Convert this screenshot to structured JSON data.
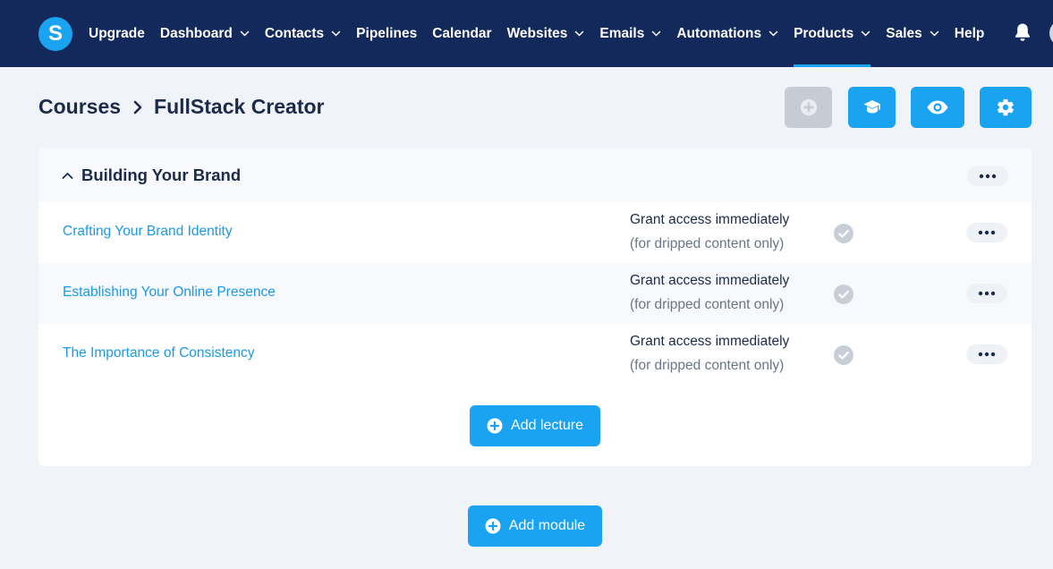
{
  "app": {
    "logo_letter": "S"
  },
  "nav": {
    "items": [
      {
        "label": "Upgrade",
        "dropdown": false
      },
      {
        "label": "Dashboard",
        "dropdown": true
      },
      {
        "label": "Contacts",
        "dropdown": true
      },
      {
        "label": "Pipelines",
        "dropdown": false
      },
      {
        "label": "Calendar",
        "dropdown": false
      },
      {
        "label": "Websites",
        "dropdown": true
      },
      {
        "label": "Emails",
        "dropdown": true
      },
      {
        "label": "Automations",
        "dropdown": true
      },
      {
        "label": "Products",
        "dropdown": true,
        "active": true
      },
      {
        "label": "Sales",
        "dropdown": true
      },
      {
        "label": "Help",
        "dropdown": false
      }
    ]
  },
  "breadcrumb": {
    "root": "Courses",
    "current": "FullStack Creator"
  },
  "header_actions": [
    {
      "icon": "plus-circle-icon",
      "disabled": true
    },
    {
      "icon": "graduation-cap-icon",
      "disabled": false
    },
    {
      "icon": "eye-icon",
      "disabled": false
    },
    {
      "icon": "gear-icon",
      "disabled": false
    }
  ],
  "module": {
    "title": "Building Your Brand",
    "expanded": true,
    "lectures": [
      {
        "title": "Crafting Your Brand Identity",
        "access": "Grant access immediately",
        "access_note": "(for dripped content only)"
      },
      {
        "title": "Establishing Your Online Presence",
        "access": "Grant access immediately",
        "access_note": "(for dripped content only)"
      },
      {
        "title": "The Importance of Consistency",
        "access": "Grant access immediately",
        "access_note": "(for dripped content only)"
      }
    ],
    "add_lecture_label": "Add lecture"
  },
  "add_module_label": "Add module",
  "colors": {
    "nav_bg": "#13295c",
    "accent": "#1aa3f0",
    "link": "#1a9ae6",
    "page_bg": "#f0f4f9",
    "disabled": "#c7ccd4"
  }
}
